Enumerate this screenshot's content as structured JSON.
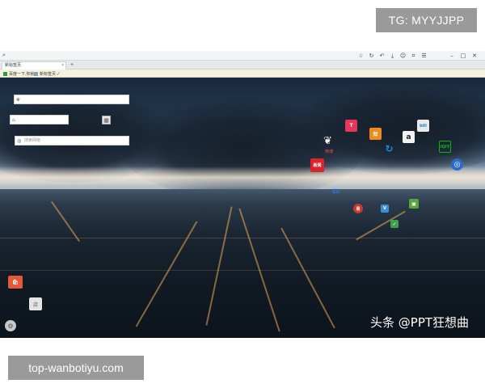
{
  "overlay": {
    "tg_badge": "TG: MYYJJPP",
    "site_badge": "top-wanbotiyu.com",
    "watermark": "头条 @PPT狂想曲"
  },
  "browser": {
    "address_icon": "search-icon",
    "toolbar_icons": [
      "star-icon",
      "refresh-icon",
      "undo-icon",
      "download-icon",
      "user-icon",
      "crop-icon",
      "menu-icon",
      "more-icon"
    ],
    "window_controls": [
      "minimize-icon",
      "maximize-icon",
      "close-icon"
    ],
    "tab": {
      "title": "新标签页",
      "close": "×"
    },
    "new_tab": "+",
    "bookmarks": [
      {
        "label": "百度一下,你就",
        "icon": "green-square-icon"
      },
      {
        "label": "新标签页 ✓",
        "icon": "page-icon"
      }
    ]
  },
  "desktop": {
    "search_boxes": [
      {
        "icon": "paw-icon",
        "placeholder": ""
      },
      {
        "icon": "home-icon",
        "placeholder": ""
      },
      {
        "icon": "globe-icon",
        "placeholder": "搜索网络"
      }
    ],
    "apps": [
      {
        "name": "weibo",
        "label": "微博",
        "color": "#d22d2d",
        "glyph": "微"
      },
      {
        "name": "toutiao",
        "label": "",
        "color": "#e8355b",
        "glyph": "T"
      },
      {
        "name": "zhihu-orange",
        "label": "",
        "color": "#f08a1d",
        "glyph": "知"
      },
      {
        "name": "bilibili",
        "label": "",
        "color": "#e9e9e9",
        "glyph": "bili"
      },
      {
        "name": "amazon",
        "label": "",
        "color": "#f2f2f2",
        "glyph": "a"
      },
      {
        "name": "iqiyi",
        "label": "",
        "color": "#00be06",
        "glyph": "iQIY"
      },
      {
        "name": "refresh-blue",
        "label": "",
        "color": "#1a8fe3",
        "glyph": "↻"
      },
      {
        "name": "news",
        "label": "",
        "color": "#d8262c",
        "glyph": "新闻"
      },
      {
        "name": "target",
        "label": "",
        "color": "#2e6bc7",
        "glyph": "◎"
      },
      {
        "name": "baidu",
        "label": "",
        "color": "#2f6fd5",
        "glyph": "du"
      },
      {
        "name": "netease",
        "label": "",
        "color": "#c73a2f",
        "glyph": "易"
      },
      {
        "name": "green-app",
        "label": "",
        "color": "#58a63b",
        "glyph": "▣"
      },
      {
        "name": "vip",
        "label": "",
        "color": "#3a8ed8",
        "glyph": "V"
      },
      {
        "name": "leaf",
        "label": "",
        "color": "#3f9e4b",
        "glyph": "✓"
      },
      {
        "name": "store",
        "label": "",
        "color": "#e4e4e4",
        "glyph": "店"
      }
    ]
  }
}
